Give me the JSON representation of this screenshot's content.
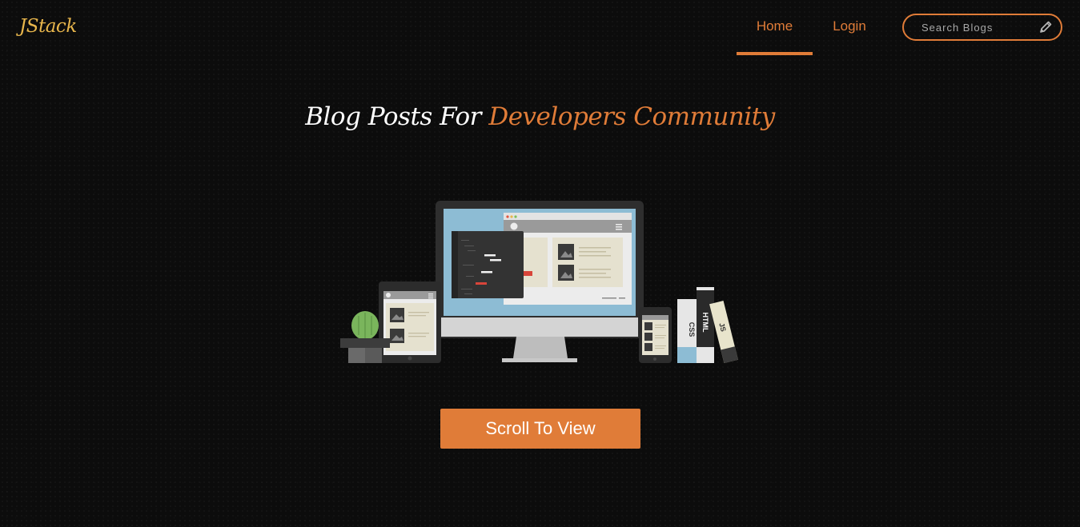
{
  "brand": {
    "logo_text": "JStack"
  },
  "nav": {
    "items": [
      {
        "label": "Home",
        "active": true
      },
      {
        "label": "Login",
        "active": false
      }
    ]
  },
  "search": {
    "placeholder": "Search Blogs",
    "value": "",
    "icon": "pencil-icon"
  },
  "hero": {
    "headline_part1": "Blog Posts For",
    "headline_part2": "Developers Community",
    "illustration_labels": {
      "css": "CSS",
      "html": "HTML",
      "js": "JS"
    },
    "cta_label": "Scroll To View"
  },
  "colors": {
    "accent": "#e07c38",
    "logo": "#e8b64c",
    "background": "#0c0c0c"
  }
}
